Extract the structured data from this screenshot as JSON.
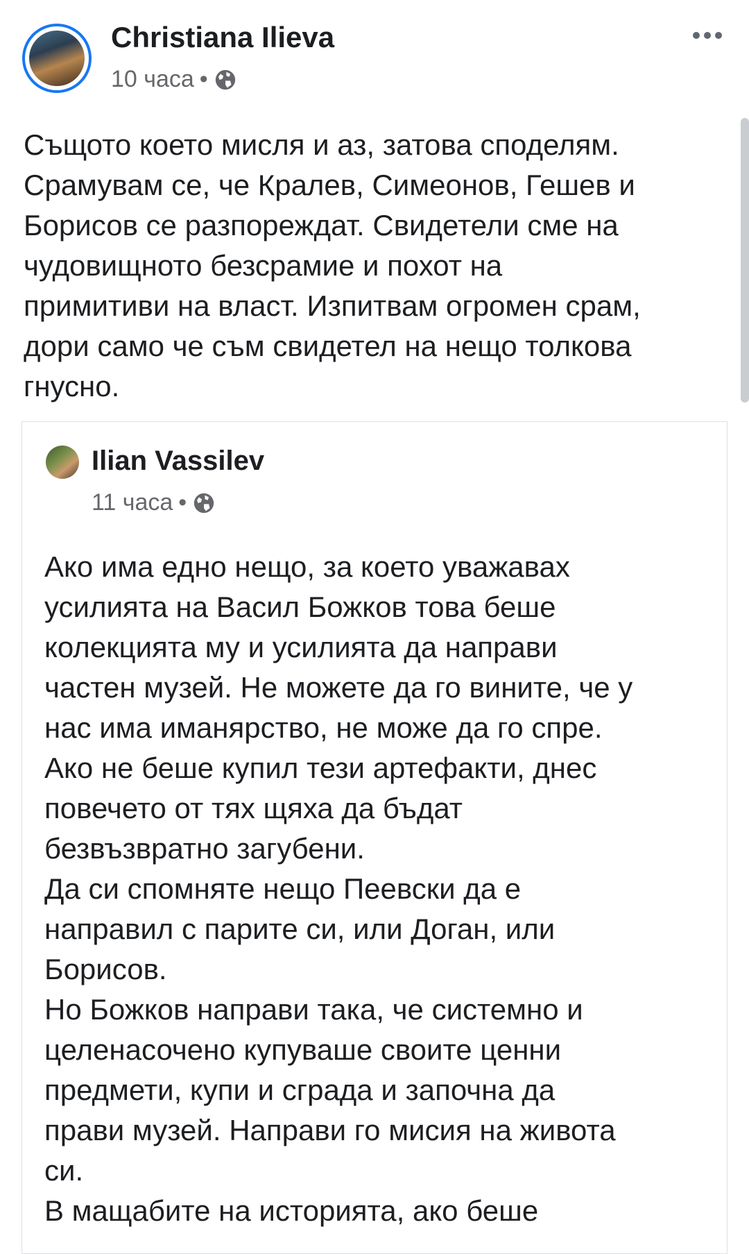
{
  "post": {
    "author": "Christiana Ilieva",
    "time": "10 часа",
    "separator": "•",
    "privacy_icon": "globe-icon",
    "more_icon": "more-options-icon",
    "text": "Същото което мисля и аз, затова споделям.\nСрамувам се, че Кралев, Симеонов, Гешев и\nБорисов се разпореждат. Свидетели сме на\nчудовищното  безсрамие и похот на\nпримитиви на власт. Изпитвам огромен срам,\nдори само че съм свидетел на нещо толкова\nгнусно."
  },
  "shared": {
    "author": "Ilian Vassilev",
    "time": "11 часа",
    "separator": "•",
    "privacy_icon": "globe-icon",
    "text": "Ако има едно нещо, за което уважавах\nусилията на Васил Божков това беше\nколекцията му и усилията да направи\nчастен музей. Не можете да го вините, че у\nнас има иманярство, не може да го спре.\nАко не беше купил тези артефакти, днес\nповечето от тях щяха да бъдат\nбезвъзвратно загубени.\nДа си спомняте нещо Пеевски да е\nнаправил с парите си, или Доган, или\nБорисов.\nНо Божков направи така, че системно и\nцеленасочено купуваше своите ценни\nпредмети, купи и сграда и започна да\nправи музей. Направи го мисия на живота\nси.\nВ мащабите на историята, ако беше"
  },
  "colors": {
    "accent": "#1877f2",
    "text": "#1c1e21",
    "secondary_text": "#65676b",
    "border": "#dddfe2"
  }
}
